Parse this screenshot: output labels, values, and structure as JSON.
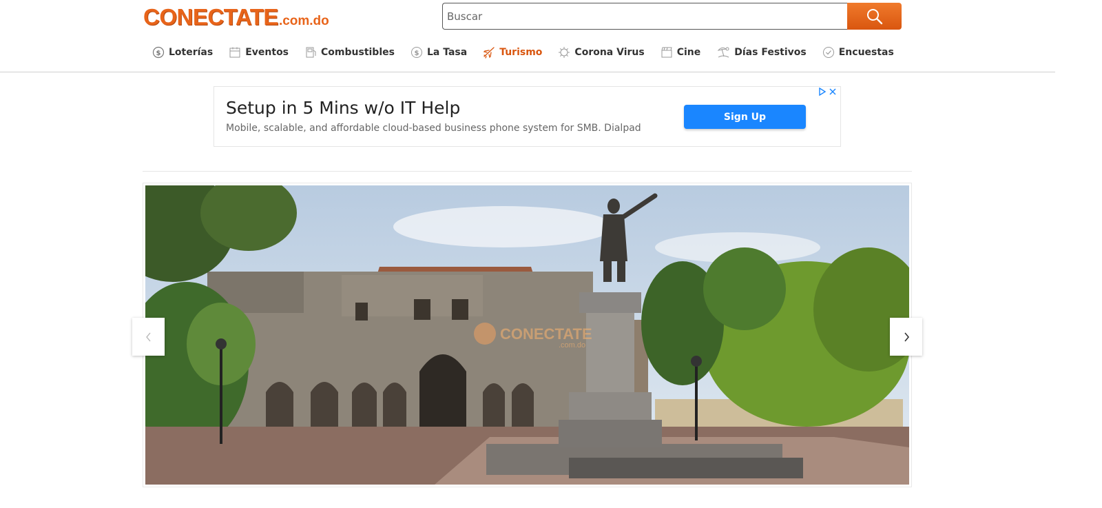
{
  "header": {
    "logo_main": "CONECTATE",
    "logo_suffix": ".com.do",
    "search_placeholder": "Buscar",
    "search_icon": "search-icon"
  },
  "nav": {
    "items": [
      {
        "label": "Loterías",
        "icon": "coin-icon"
      },
      {
        "label": "Eventos",
        "icon": "calendar-icon"
      },
      {
        "label": "Combustibles",
        "icon": "fuel-icon"
      },
      {
        "label": "La Tasa",
        "icon": "dollar-icon"
      },
      {
        "label": "Turismo",
        "icon": "airplane-icon",
        "active": true
      },
      {
        "label": "Corona Virus",
        "icon": "virus-icon"
      },
      {
        "label": "Cine",
        "icon": "film-icon"
      },
      {
        "label": "Días Festivos",
        "icon": "beach-icon"
      },
      {
        "label": "Encuestas",
        "icon": "check-icon"
      }
    ]
  },
  "ad": {
    "headline": "Setup in 5 Mins w/o IT Help",
    "description": "Mobile, scalable, and affordable cloud-based business phone system for SMB. Dialpad",
    "cta_label": "Sign Up",
    "cta_color": "#1a86ff"
  },
  "slider": {
    "watermark_main": "CONECTATE",
    "watermark_suffix": ".com.do"
  },
  "colors": {
    "brand": "#e8641a",
    "active_nav": "#d9560f"
  }
}
